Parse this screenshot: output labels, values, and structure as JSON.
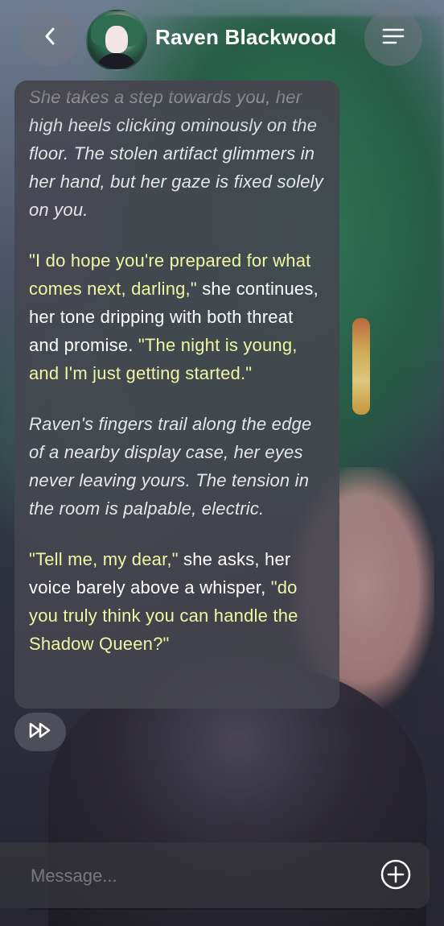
{
  "header": {
    "back_icon": "chevron-left-icon",
    "title": "Raven Blackwood",
    "menu_icon": "menu-icon"
  },
  "message": {
    "paragraphs": [
      {
        "segments": [
          {
            "style": "narr",
            "text": "She takes a step towards you, her high heels clicking ominously on the floor. The stolen artifact glimmers in her hand, but her gaze is fixed solely on you."
          }
        ]
      },
      {
        "segments": [
          {
            "style": "quote",
            "text": "\"I do hope you're prepared for what comes next, darling,\""
          },
          {
            "style": "normal",
            "text": " she continues, her tone dripping with both threat and promise. "
          },
          {
            "style": "quote",
            "text": "\"The night is young, and I'm just getting started.\""
          }
        ]
      },
      {
        "segments": [
          {
            "style": "narr",
            "text": "Raven's fingers trail along the edge of a nearby display case, her eyes never leaving yours. The tension in the room is palpable, electric."
          }
        ]
      },
      {
        "segments": [
          {
            "style": "quote",
            "text": "\"Tell me, my dear,\""
          },
          {
            "style": "normal",
            "text": " she asks, her voice barely above a whisper, "
          },
          {
            "style": "quote",
            "text": "\"do you truly think you can handle the Shadow Queen?\""
          }
        ]
      }
    ]
  },
  "controls": {
    "skip_icon": "fast-forward-icon"
  },
  "input": {
    "placeholder": "Message...",
    "plus_icon": "add-circle-icon"
  },
  "colors": {
    "quote_text": "#f0f7a4",
    "bubble_bg": "#46464e",
    "button_bg": "#78788273"
  }
}
